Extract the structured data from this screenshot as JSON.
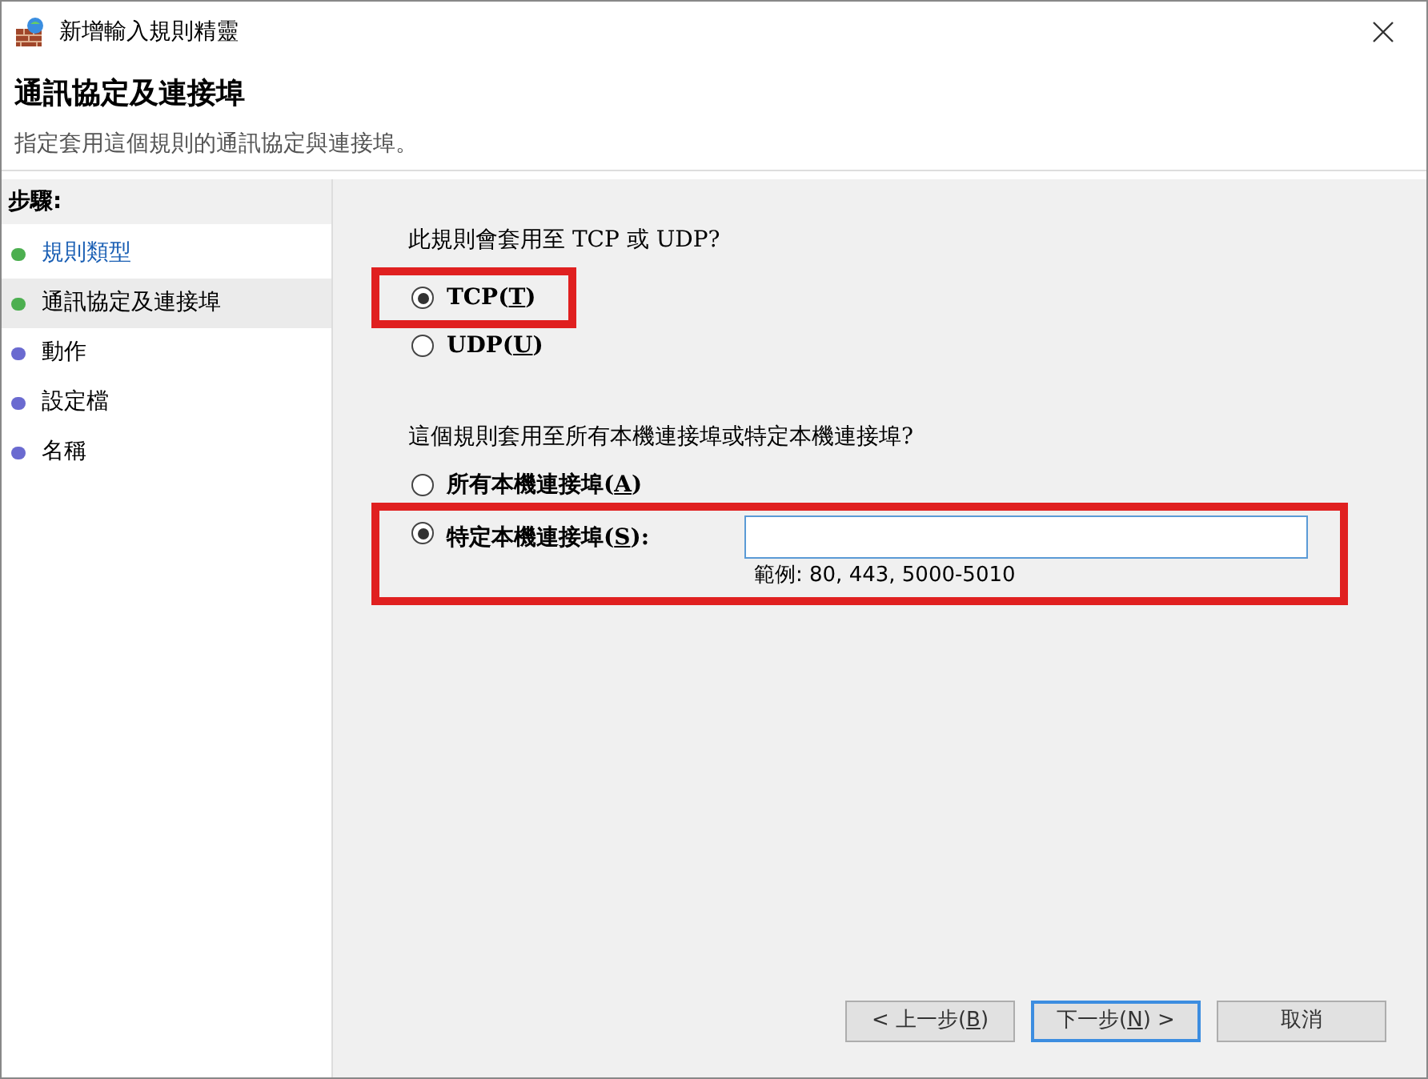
{
  "window": {
    "title": "新增輸入規則精靈"
  },
  "header": {
    "title": "通訊協定及連接埠",
    "subtitle": "指定套用這個規則的通訊協定與連接埠。"
  },
  "steps_heading": "步驟:",
  "steps": [
    {
      "label": "規則類型",
      "completed": true,
      "selected": false,
      "color": "#4caf50"
    },
    {
      "label": "通訊協定及連接埠",
      "completed": false,
      "selected": true,
      "color": "#4caf50"
    },
    {
      "label": "動作",
      "completed": false,
      "selected": false,
      "color": "#6a6ad0"
    },
    {
      "label": "設定檔",
      "completed": false,
      "selected": false,
      "color": "#6a6ad0"
    },
    {
      "label": "名稱",
      "completed": false,
      "selected": false,
      "color": "#6a6ad0"
    }
  ],
  "protocol_question": "此規則會套用至 TCP 或 UDP?",
  "protocols": [
    {
      "before": "TCP(",
      "key": "T",
      "after": ")",
      "selected": true
    },
    {
      "before": "UDP(",
      "key": "U",
      "after": ")",
      "selected": false
    }
  ],
  "port_question": "這個規則套用至所有本機連接埠或特定本機連接埠?",
  "port_options": [
    {
      "before": "所有本機連接埠(",
      "key": "A",
      "after": ")",
      "selected": false
    },
    {
      "before": "特定本機連接埠(",
      "key": "S",
      "after": "):",
      "selected": true
    }
  ],
  "port_field": {
    "focused": true
  },
  "port_example": "範例: 80, 443, 5000-5010",
  "buttons": [
    {
      "before": "< 上一步(",
      "key": "B",
      "after": ")",
      "kind": "back",
      "disabled": false
    },
    {
      "before": "下一步(",
      "key": "N",
      "after": ") >",
      "kind": "next",
      "disabled": false
    },
    {
      "before": "取消",
      "kind": "cancel",
      "disabled": false
    }
  ]
}
